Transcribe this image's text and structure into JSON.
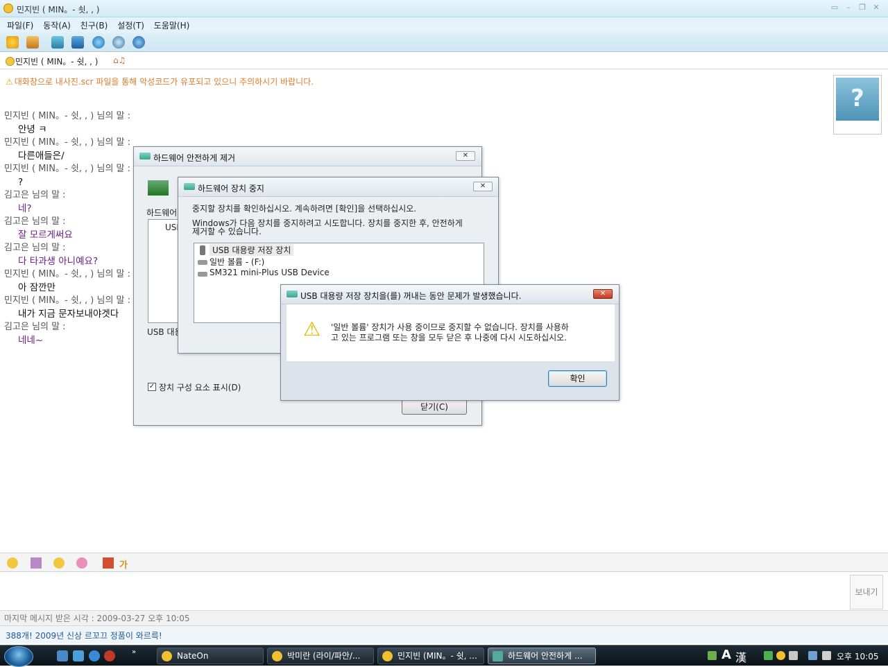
{
  "window": {
    "title": "민지빈 ( MIN。- 쇳, , )"
  },
  "menu": [
    "파일(F)",
    "동작(A)",
    "친구(B)",
    "설정(T)",
    "도움말(H)"
  ],
  "peer": {
    "name": "민지빈 ( MIN。- 쉿, , )"
  },
  "warning": "대화창으로 내사진.scr 파일을 통해 악성코드가 유포되고 있으니 주의하시기 바랍니다.",
  "chat": [
    {
      "speaker": "민지빈 ( MIN。- 쉿, , ) 님의 말 :",
      "text": "안녕 ㅋ",
      "style": "normal"
    },
    {
      "speaker": "민지빈 ( MIN。- 쉿, , ) 님의 말 :",
      "text": "다른애들은/",
      "style": "normal"
    },
    {
      "speaker": "민지빈 ( MIN。- 쉿, , ) 님의 말 :",
      "text": "?",
      "style": "normal"
    },
    {
      "speaker": "김고은 님의 말 :",
      "text": "네?",
      "style": "purple"
    },
    {
      "speaker": "김고은 님의 말 :",
      "text": "잘 모르게써요",
      "style": "purple"
    },
    {
      "speaker": "김고은 님의 말 :",
      "text": "다 타과생 아니예요?",
      "style": "purple"
    },
    {
      "speaker": "민지빈 ( MIN。- 쉿, , ) 님의 말 :",
      "text": "아 잠깐만",
      "style": "normal"
    },
    {
      "speaker": "민지빈 ( MIN。- 쉿, , ) 님의 말 :",
      "text": "내가 지금 문자보내야겟다",
      "style": "normal"
    },
    {
      "speaker": "김고은 님의 말 :",
      "text": "네네~",
      "style": "purple"
    }
  ],
  "avatar_glyph": "?",
  "send_label": "보내기",
  "status_text": "마지막 메시지 받은 시각 : 2009-03-27 오후 10:05",
  "ad_text": "388개! 2009년 신상 르꼬끄 정품이 와르륵!",
  "dialog_remove": {
    "title": "하드웨어 안전하게 제거",
    "list_label": "하드웨어",
    "tree_item": "USB",
    "bottom_label": "USB 대용",
    "checkbox_label": "장치 구성 요소 표시(D)",
    "close_button": "닫기(C)"
  },
  "dialog_stop": {
    "title": "하드웨어 장치 중지",
    "line1": "중지할 장치를 확인하십시오. 계속하려면 [확인]을 선택하십시오.",
    "line2": "Windows가 다음 장치를 중지하려고 시도합니다. 장치를 중지한 후, 안전하게",
    "line3": "제거할 수 있습니다.",
    "items": [
      "USB 대용량 저장 장치",
      "일반 볼륨 - (F:)",
      "SM321 mini-Plus USB Device"
    ]
  },
  "dialog_error": {
    "title": "USB 대용량 저장 장치을(를) 꺼내는 동안 문제가 발생했습니다.",
    "message1": "'일반 볼륨' 장치가 사용 중이므로 중지할 수 없습니다. 장치를 사용하",
    "message2": "고 있는 프로그램 또는 창을 모두 닫은 후 나중에 다시 시도하십시오.",
    "ok_label": "확인"
  },
  "taskbar": {
    "tasks": [
      "NateOn",
      "박미란 (라이/파안/...",
      "민지빈 (MIN。- 쉿, ...",
      "하드웨어 안전하게 ..."
    ],
    "lang_a": "A",
    "lang_han": "漢",
    "clock": "오후 10:05"
  }
}
